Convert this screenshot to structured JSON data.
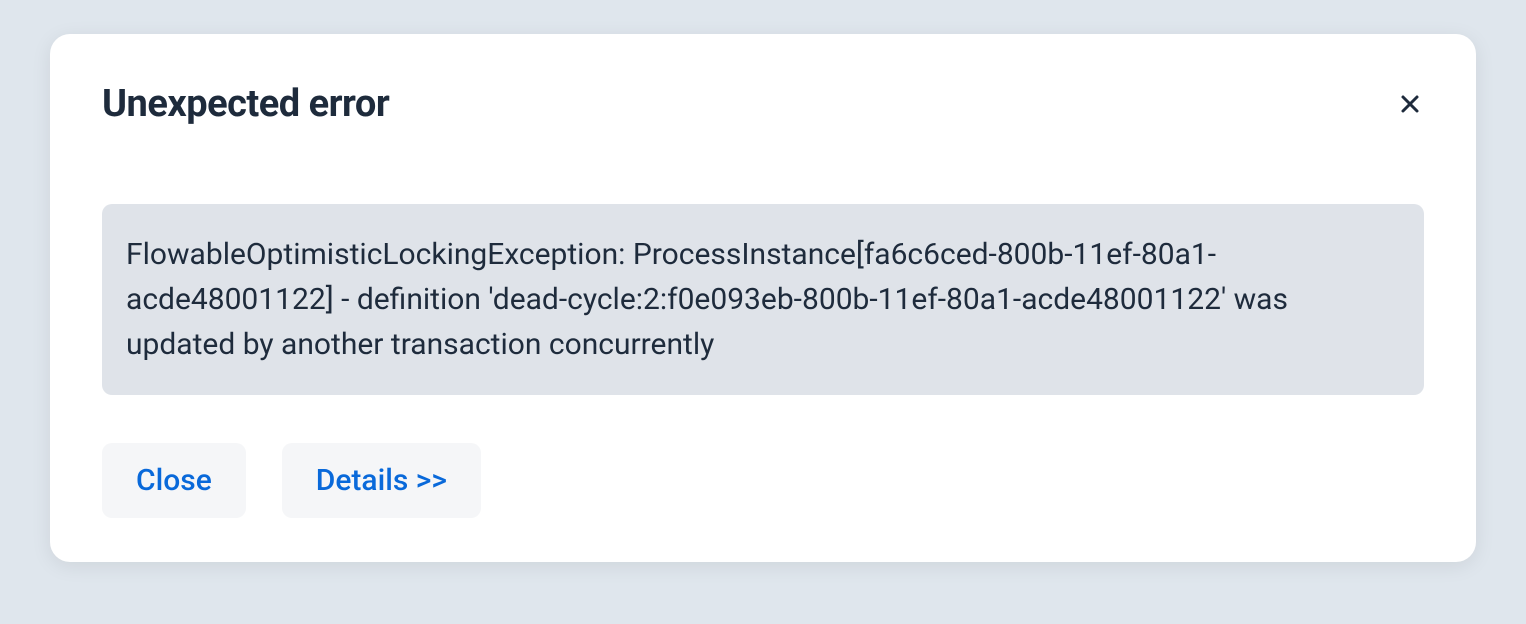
{
  "modal": {
    "title": "Unexpected error",
    "error_message": "FlowableOptimisticLockingException: ProcessInstance[fa6c6ced-800b-11ef-80a1-acde48001122] - definition 'dead-cycle:2:f0e093eb-800b-11ef-80a1-acde48001122' was updated by another transaction concurrently",
    "close_label": "Close",
    "details_label": "Details >>"
  }
}
